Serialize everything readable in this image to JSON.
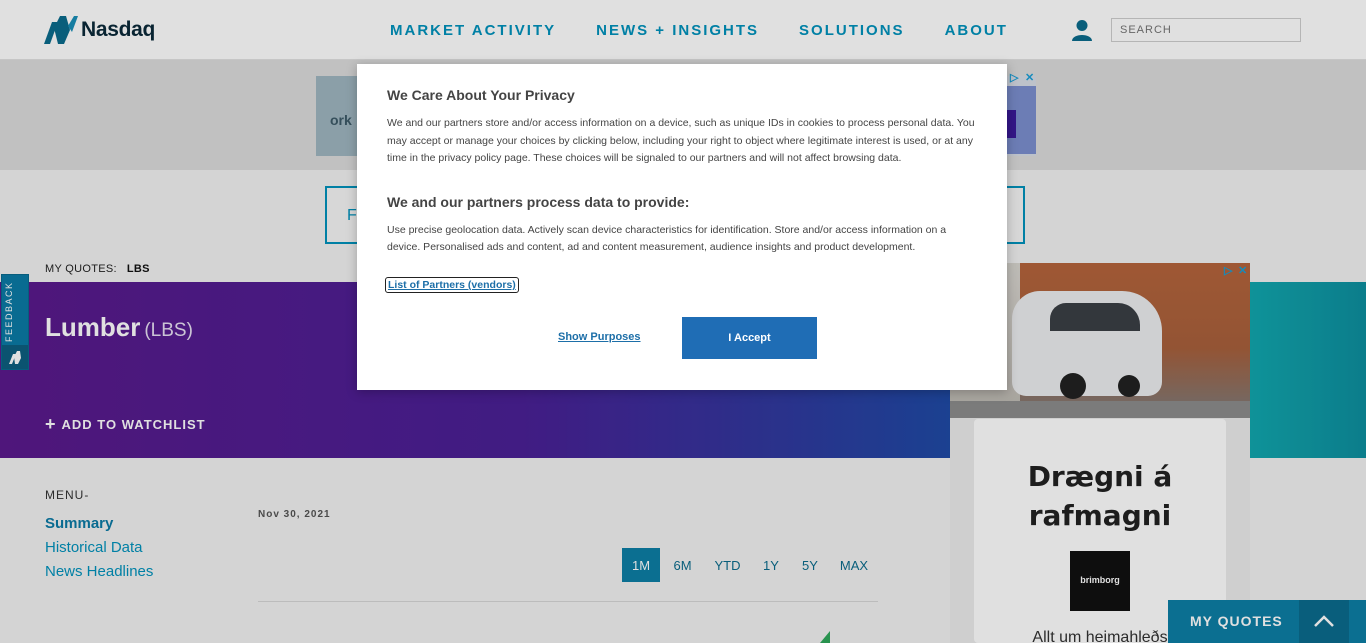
{
  "header": {
    "logo_text": "Nasdaq",
    "nav": [
      "MARKET ACTIVITY",
      "NEWS + INSIGHTS",
      "SOLUTIONS",
      "ABOUT"
    ],
    "search_placeholder": "SEARCH"
  },
  "top_ad": {
    "partial_text": "ork",
    "partial_filter_text": "F"
  },
  "my_quotes": {
    "label": "MY QUOTES:",
    "symbol": "LBS"
  },
  "hero": {
    "title": "Lumber",
    "symbol": "(LBS)",
    "watchlist_label": "ADD TO WATCHLIST"
  },
  "feedback": {
    "label": "FEEDBACK"
  },
  "menu": {
    "label": "MENU-",
    "items": [
      "Summary",
      "Historical Data",
      "News Headlines"
    ]
  },
  "chart_section": {
    "date": "Nov 30, 2021",
    "ranges": [
      "1M",
      "6M",
      "YTD",
      "1Y",
      "5Y",
      "MAX"
    ],
    "active_range": "1M"
  },
  "right_ad": {
    "title": "Drægni á rafmagni",
    "brand": "brimborg",
    "tagline": "Allt um heimahleðs"
  },
  "quotes_bar": {
    "label": "MY QUOTES"
  },
  "consent": {
    "title": "We Care About Your Privacy",
    "body1": "We and our partners store and/or access information on a device, such as unique IDs in cookies to process personal data. You may accept or manage your choices by clicking below, including your right to object where legitimate interest is used, or at any time in the privacy policy page. These choices will be signaled to our partners and will not affect browsing data.",
    "subtitle": "We and our partners process data to provide:",
    "body2": "Use precise geolocation data. Actively scan device characteristics for identification. Store and/or access information on a device. Personalised ads and content, ad and content measurement, audience insights and product development.",
    "partners_link": "List of Partners (vendors)",
    "show_purposes": "Show Purposes",
    "accept": "I Accept"
  },
  "colors": {
    "brand_blue": "#0092bc",
    "hero_purple": "#5a1a8c",
    "accept_blue": "#1f6db5"
  }
}
